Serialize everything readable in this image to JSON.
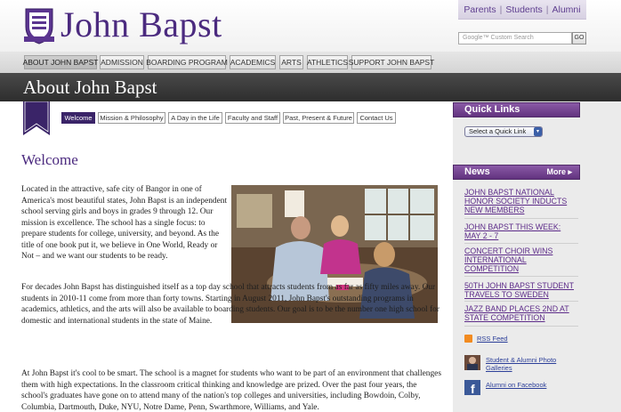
{
  "header": {
    "site_title": "John Bapst",
    "utility_links": [
      "Parents",
      "Students",
      "Alumni"
    ],
    "search_placeholder": "Google™ Custom Search",
    "search_go": "GO"
  },
  "main_nav": [
    {
      "label": "ABOUT JOHN BAPST",
      "active": true
    },
    {
      "label": "ADMISSION"
    },
    {
      "label": "BOARDING PROGRAM"
    },
    {
      "label": "ACADEMICS"
    },
    {
      "label": "ARTS"
    },
    {
      "label": "ATHLETICS"
    },
    {
      "label": "SUPPORT JOHN BAPST"
    }
  ],
  "page_title": "About John Bapst",
  "sub_nav": [
    {
      "label": "Welcome",
      "active": true
    },
    {
      "label": "Mission & Philosophy"
    },
    {
      "label": "A Day in the Life"
    },
    {
      "label": "Faculty and Staff"
    },
    {
      "label": "Past, Present & Future"
    },
    {
      "label": "Contact Us"
    }
  ],
  "content": {
    "heading": "Welcome",
    "para1": "Located in the attractive, safe city of Bangor in one of America's most beautiful states, John Bapst is an independent school serving girls and boys in grades 9 through 12.  Our mission is excellence.  The school has a single focus: to prepare students for college, university, and beyond.  As the title of one book put it, we believe in One World, Ready or Not – and we want our students to be ready.",
    "para2": "For decades John Bapst has distinguished itself as a top day school that attracts students from as far as fifty miles away.  Our students in 2010-11 come from more than forty towns.  Starting in August 2011, John Bapst's outstanding programs in academics, athletics, and the arts will also be available to boarding students.  Our goal is to be the number one high school for domestic and international students in the state of Maine.",
    "para3": "At John Bapst it's cool to be smart.  The school is a magnet for students who want to be part of an environment that challenges them with high expectations. In the classroom critical thinking and knowledge are prized.  Over the past four years, the school's graduates have gone on to attend many of the nation's top colleges and universities, including Bowdoin, Colby, Columbia, Dartmouth, Duke, NYU, Notre Dame, Penn, Swarthmore, Williams, and Yale."
  },
  "sidebar": {
    "quick_links_title": "Quick Links",
    "quick_link_select": "Select a Quick Link",
    "news_title": "News",
    "news_more": "More ▸",
    "news_items": [
      "JOHN BAPST NATIONAL HONOR SOCIETY INDUCTS NEW MEMBERS",
      "JOHN BAPST THIS WEEK: MAY 2 - 7",
      "CONCERT CHOIR WINS INTERNATIONAL COMPETITION",
      "50TH JOHN BAPST STUDENT TRAVELS TO SWEDEN",
      "JAZZ BAND PLACES 2ND AT STATE COMPETITION"
    ],
    "rss_label": "RSS Feed",
    "gallery_label": "Student & Alumni Photo Galleries",
    "facebook_label": "Alumni on Facebook"
  },
  "colors": {
    "brand_purple": "#4b2a7f",
    "sidebar_head": "#6e3d8c",
    "title_bar": "#3a3a3a"
  }
}
